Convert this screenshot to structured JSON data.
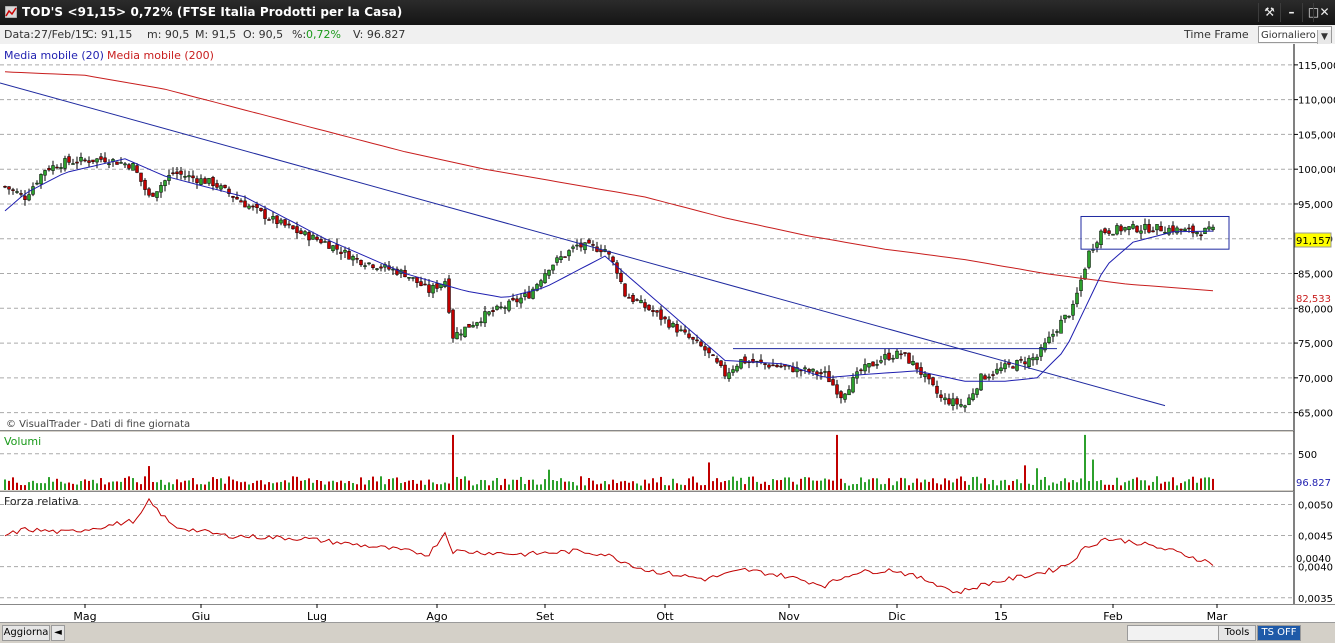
{
  "window": {
    "title": "TOD'S <91,15>  0,72%  (FTSE Italia Prodotti per la Casa)",
    "buttons": [
      "tool-icon",
      "minimize-icon",
      "restore-icon",
      "close-icon"
    ]
  },
  "infobar": {
    "data": "Data:27/Feb/15",
    "close": "C: 91,15",
    "min": "m: 90,5",
    "max": "M: 91,5",
    "open": "O: 90,5",
    "pct_label": "%:",
    "pct_value": "0,72%",
    "volume": "V: 96.827",
    "timeframe_label": "Time Frame",
    "timeframe_value": "Giornaliero"
  },
  "colors": {
    "up": "#2ca02c",
    "down": "#c00000",
    "ma20": "#1f1fb0",
    "ma200": "#c81e1e",
    "trend": "#1f2aa0",
    "price_badge": "#ffff00",
    "rs_line": "#c00000"
  },
  "chart_data": [
    {
      "type": "candlestick",
      "legend": [
        "Media mobile (20)",
        "Media mobile (200)"
      ],
      "watermark": "© VisualTrader - Dati di fine giornata",
      "ylim": [
        62.5,
        118
      ],
      "yticks": [
        "65,000",
        "70,000",
        "75,000",
        "80,000",
        "85,000",
        "90,000",
        "95,000",
        "100,000",
        "105,000",
        "110,000",
        "115,000"
      ],
      "last_price": "91,157",
      "ma200_last": "82,533",
      "x_months": [
        "Mag",
        "Giu",
        "Lug",
        "Ago",
        "Set",
        "Ott",
        "Nov",
        "Dic",
        "15",
        "Feb",
        "Mar"
      ],
      "anchors": [
        [
          0,
          97.5
        ],
        [
          5,
          96
        ],
        [
          10,
          100
        ],
        [
          15,
          101
        ],
        [
          25,
          101.5
        ],
        [
          32,
          100.5
        ],
        [
          36,
          96
        ],
        [
          42,
          99.5
        ],
        [
          52,
          98
        ],
        [
          60,
          95
        ],
        [
          66,
          93
        ],
        [
          73,
          91
        ],
        [
          80,
          89.5
        ],
        [
          88,
          87
        ],
        [
          100,
          85
        ],
        [
          106,
          82.5
        ],
        [
          110,
          84
        ],
        [
          112,
          76
        ],
        [
          120,
          79
        ],
        [
          126,
          80.5
        ],
        [
          131,
          82
        ],
        [
          136,
          86
        ],
        [
          143,
          89
        ],
        [
          150,
          88.5
        ],
        [
          153,
          85.5
        ],
        [
          155,
          82
        ],
        [
          162,
          79.5
        ],
        [
          168,
          77
        ],
        [
          175,
          74
        ],
        [
          180,
          70.5
        ],
        [
          184,
          72.5
        ],
        [
          195,
          71.5
        ],
        [
          205,
          70.5
        ],
        [
          209,
          67.5
        ],
        [
          214,
          71
        ],
        [
          220,
          73
        ],
        [
          224,
          73.5
        ],
        [
          228,
          71.5
        ],
        [
          234,
          67
        ],
        [
          240,
          66
        ],
        [
          244,
          70
        ],
        [
          250,
          71.5
        ],
        [
          258,
          73
        ],
        [
          264,
          78
        ],
        [
          267,
          80
        ],
        [
          271,
          88
        ],
        [
          274,
          91
        ],
        [
          280,
          91.5
        ],
        [
          290,
          91.5
        ],
        [
          297,
          91
        ],
        [
          302,
          91.15
        ]
      ],
      "ma20_anchors": [
        [
          0,
          94
        ],
        [
          5,
          96.5
        ],
        [
          15,
          99.5
        ],
        [
          30,
          101.5
        ],
        [
          40,
          99
        ],
        [
          60,
          96
        ],
        [
          80,
          90
        ],
        [
          100,
          85
        ],
        [
          115,
          82.5
        ],
        [
          125,
          81.5
        ],
        [
          135,
          83
        ],
        [
          150,
          87.5
        ],
        [
          165,
          80
        ],
        [
          180,
          72.5
        ],
        [
          195,
          72
        ],
        [
          205,
          70
        ],
        [
          215,
          70.5
        ],
        [
          228,
          71
        ],
        [
          240,
          69.5
        ],
        [
          250,
          69.5
        ],
        [
          258,
          70
        ],
        [
          265,
          74
        ],
        [
          270,
          80
        ],
        [
          275,
          86
        ],
        [
          282,
          89.5
        ],
        [
          292,
          91
        ],
        [
          302,
          91.1
        ]
      ],
      "ma200_anchors": [
        [
          0,
          114
        ],
        [
          20,
          113.5
        ],
        [
          40,
          111.5
        ],
        [
          60,
          108.5
        ],
        [
          80,
          105.5
        ],
        [
          100,
          102.5
        ],
        [
          120,
          100
        ],
        [
          140,
          98
        ],
        [
          160,
          96
        ],
        [
          180,
          93
        ],
        [
          200,
          90.5
        ],
        [
          220,
          88.5
        ],
        [
          240,
          87
        ],
        [
          260,
          85
        ],
        [
          280,
          83.5
        ],
        [
          302,
          82.53
        ]
      ],
      "trend_line": [
        [
          0,
          112.4
        ],
        [
          290,
          66
        ]
      ],
      "resistance_line": [
        [
          182,
          74.2
        ],
        [
          263,
          74.2
        ]
      ],
      "box": [
        [
          269,
          88.5
        ],
        [
          306,
          93.2
        ]
      ]
    },
    {
      "type": "bar",
      "name": "Volumi",
      "ylim": [
        0,
        800
      ],
      "yticks": [
        "500"
      ],
      "last_value": "96.827"
    },
    {
      "type": "line",
      "name": "Forza relativa",
      "ylim": [
        0.0034,
        0.0052
      ],
      "yticks": [
        "0,0050",
        "0,0045",
        "0,0040",
        "0,0035"
      ],
      "last_value": "0,0040",
      "anchors": [
        [
          0,
          0.0045
        ],
        [
          5,
          0.0046
        ],
        [
          15,
          0.00455
        ],
        [
          25,
          0.00465
        ],
        [
          33,
          0.00475
        ],
        [
          36,
          0.00505
        ],
        [
          42,
          0.00465
        ],
        [
          55,
          0.0045
        ],
        [
          75,
          0.00445
        ],
        [
          95,
          0.0043
        ],
        [
          106,
          0.0042
        ],
        [
          110,
          0.00455
        ],
        [
          112,
          0.00425
        ],
        [
          130,
          0.0042
        ],
        [
          143,
          0.00425
        ],
        [
          150,
          0.0042
        ],
        [
          160,
          0.00395
        ],
        [
          175,
          0.0038
        ],
        [
          185,
          0.00395
        ],
        [
          195,
          0.00385
        ],
        [
          205,
          0.0037
        ],
        [
          212,
          0.0039
        ],
        [
          222,
          0.00395
        ],
        [
          232,
          0.00375
        ],
        [
          238,
          0.00358
        ],
        [
          245,
          0.00372
        ],
        [
          255,
          0.00385
        ],
        [
          262,
          0.00395
        ],
        [
          266,
          0.00405
        ],
        [
          270,
          0.0043
        ],
        [
          275,
          0.00445
        ],
        [
          282,
          0.0044
        ],
        [
          292,
          0.00425
        ],
        [
          302,
          0.00405
        ]
      ]
    }
  ],
  "statusbar": {
    "left_button": "Aggiorna",
    "tools": "Tools",
    "ts": "TS OFF"
  }
}
